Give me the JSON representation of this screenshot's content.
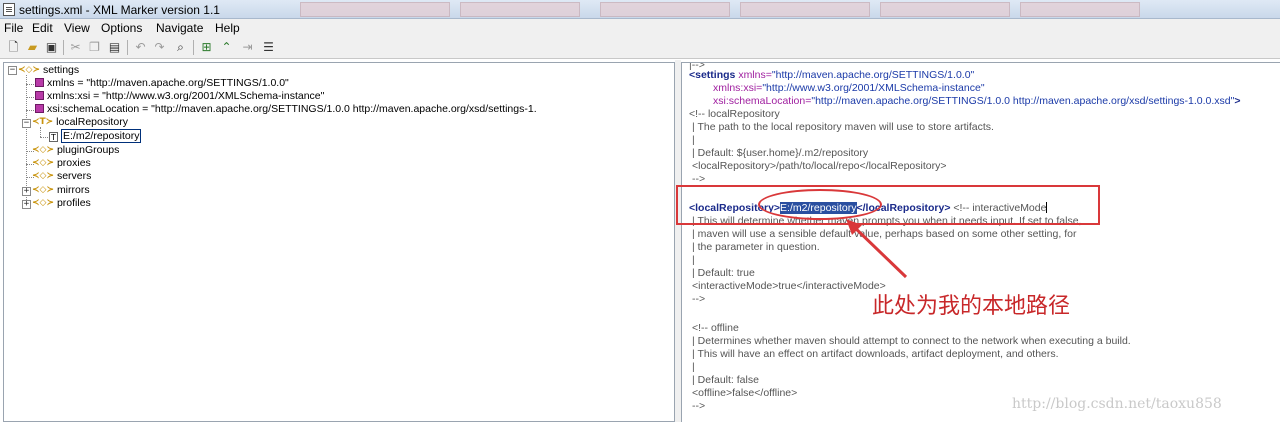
{
  "window": {
    "title": "settings.xml  -  XML Marker version 1.1"
  },
  "menu": [
    "File",
    "Edit",
    "View",
    "Options",
    "Navigate",
    "Help"
  ],
  "toolbar": {
    "icons": [
      "new-file-icon",
      "open-folder-icon",
      "save-icon",
      "cut-icon",
      "copy-icon",
      "paste-icon",
      "undo-icon",
      "redo-icon",
      "find-icon",
      "add-element-icon",
      "add-sibling-icon",
      "add-attribute-icon",
      "properties-icon"
    ]
  },
  "tree": {
    "root": "settings",
    "xmlns": "xmlns = \"http://maven.apache.org/SETTINGS/1.0.0\"",
    "xmlns_xsi": "xmlns:xsi = \"http://www.w3.org/2001/XMLSchema-instance\"",
    "schema_location": "xsi:schemaLocation = \"http://maven.apache.org/SETTINGS/1.0.0 http://maven.apache.org/xsd/settings-1.",
    "local_repository": "localRepository",
    "local_repository_value": "E:/m2/repository",
    "plugin_groups": "pluginGroups",
    "proxies": "proxies",
    "servers": "servers",
    "mirrors": "mirrors",
    "profiles": "profiles"
  },
  "xml": {
    "l0": "|-->",
    "settings_open_tag": "<settings",
    "settings_xmlns_name": "xmlns=",
    "settings_xmlns_val": "\"http://maven.apache.org/SETTINGS/1.0.0\"",
    "settings_xsi_name": "xmlns:xsi=",
    "settings_xsi_val": "\"http://www.w3.org/2001/XMLSchema-instance\"",
    "settings_loc_name": "xsi:schemaLocation=",
    "settings_loc_val": "\"http://maven.apache.org/SETTINGS/1.0.0 http://maven.apache.org/xsd/settings-1.0.0.xsd\"",
    "settings_close": ">",
    "c1": "<!-- localRepository",
    "c2": "| The path to the local repository maven will use to store artifacts.",
    "c3": "|",
    "c4": "| Default: ${user.home}/.m2/repository",
    "c5": "<localRepository>/path/to/local/repo</localRepository>",
    "c6": "-->",
    "lr_open": "<localRepository>",
    "lr_value": "E:/m2/repository",
    "lr_close": "</localRepository>",
    "lr_comment": "<!-- interactiveMode",
    "d1": "| This will determine whether maven prompts you when it needs input. If set to false,",
    "d2": "| maven will use a sensible default value, perhaps based on some other setting, for",
    "d3": "| the parameter in question.",
    "d4": "|",
    "d5": "| Default: true",
    "d6": "<interactiveMode>true</interactiveMode>",
    "d7": "-->",
    "e1": "<!-- offline",
    "e2": "| Determines whether maven should attempt to connect to the network when executing a build.",
    "e3": "| This will have an effect on artifact downloads, artifact deployment, and others.",
    "e4": "|",
    "e5": "| Default: false",
    "e6": "<offline>false</offline>",
    "e7": "-->"
  },
  "annotation": "此处为我的本地路径",
  "watermark": "http://blog.csdn.net/taoxu858",
  "colors": {
    "annotation_red": "#d9383a",
    "selection": "#2a4fa0",
    "tag": "#1a2a8a"
  }
}
